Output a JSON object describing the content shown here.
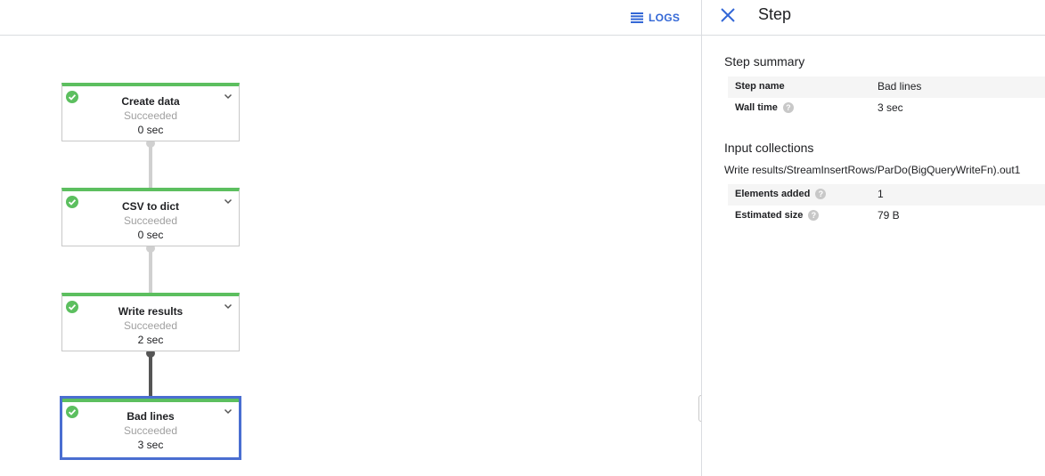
{
  "toolbar": {
    "logs_label": "LOGS"
  },
  "graph": {
    "nodes": [
      {
        "title": "Create data",
        "status": "Succeeded",
        "time": "0 sec"
      },
      {
        "title": "CSV to dict",
        "status": "Succeeded",
        "time": "0 sec"
      },
      {
        "title": "Write results",
        "status": "Succeeded",
        "time": "2 sec"
      },
      {
        "title": "Bad lines",
        "status": "Succeeded",
        "time": "3 sec"
      }
    ]
  },
  "details": {
    "title": "Step",
    "summary": {
      "heading": "Step summary",
      "rows": [
        {
          "key": "Step name",
          "value": "Bad lines"
        },
        {
          "key": "Wall time",
          "value": "3 sec"
        }
      ]
    },
    "input_collections": {
      "heading": "Input collections",
      "collection_name": "Write results/StreamInsertRows/ParDo(BigQueryWriteFn).out1",
      "rows": [
        {
          "key": "Elements added",
          "value": "1"
        },
        {
          "key": "Estimated size",
          "value": "79 B"
        }
      ]
    }
  },
  "colors": {
    "accent": "#3367d6",
    "success": "#5cbf5f",
    "selected_border": "#4a6ed1"
  },
  "icons": {
    "logs": "list-icon",
    "status": "check-circle-icon",
    "expand": "chevron-down-icon",
    "close": "close-icon",
    "help": "help-icon"
  }
}
